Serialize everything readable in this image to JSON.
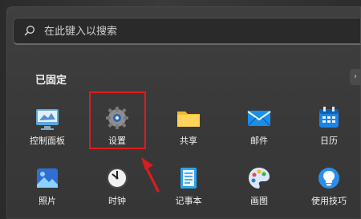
{
  "search": {
    "placeholder": "在此键入以搜索",
    "icon": "search-icon"
  },
  "pinned": {
    "title": "已固定",
    "apps": [
      {
        "label": "控制面板",
        "icon": "control-panel-icon"
      },
      {
        "label": "设置",
        "icon": "settings-icon"
      },
      {
        "label": "共享",
        "icon": "folder-icon"
      },
      {
        "label": "邮件",
        "icon": "mail-icon"
      },
      {
        "label": "日历",
        "icon": "calendar-icon"
      },
      {
        "label": "照片",
        "icon": "photos-icon"
      },
      {
        "label": "时钟",
        "icon": "clock-icon"
      },
      {
        "label": "记事本",
        "icon": "notepad-icon"
      },
      {
        "label": "画图",
        "icon": "paint-icon"
      },
      {
        "label": "使用技巧",
        "icon": "tips-icon"
      }
    ]
  },
  "annotation": {
    "highlight_color": "#e21b1b",
    "highlighted_app": "设置"
  }
}
